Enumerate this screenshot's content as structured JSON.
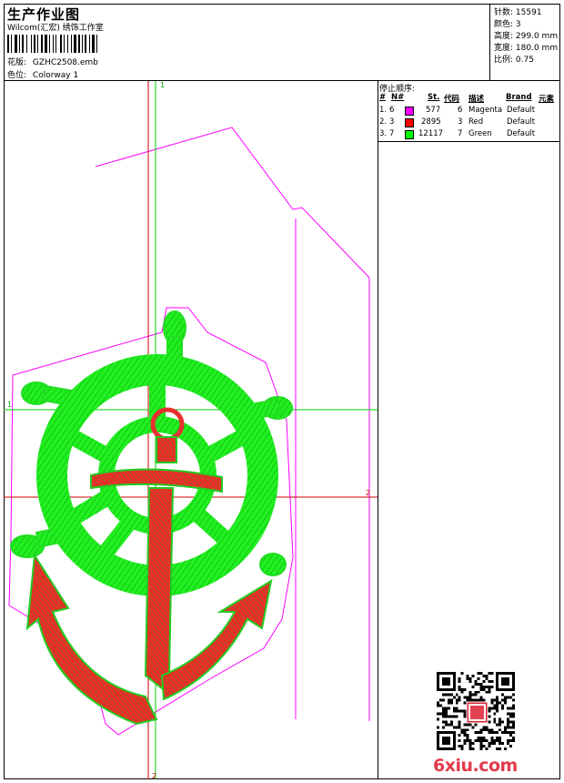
{
  "header": {
    "title": "生产作业图",
    "subtitle": "Wilcom(汇宏) 绣饰工作室",
    "design_label": "花版:",
    "design_value": "GZHC2508.emb",
    "colorway_label": "色位:",
    "colorway_value": "Colorway 1"
  },
  "stats": [
    {
      "label": "针数:",
      "value": "15591"
    },
    {
      "label": "颜色:",
      "value": "3"
    },
    {
      "label": "高度:",
      "value": "299.0 mm"
    },
    {
      "label": "宽度:",
      "value": "180.0 mm"
    },
    {
      "label": "比例:",
      "value": "0.75"
    }
  ],
  "stop_sequence": {
    "title": "停止顺序:",
    "headers": {
      "num": "#",
      "needle": "N#",
      "stitches": "St.",
      "code": "代码",
      "desc": "描述",
      "brand": "Brand",
      "element": "元素"
    },
    "rows": [
      {
        "num": "1.",
        "needle": "6",
        "color": "#ff00ff",
        "stitches": "577",
        "code": "6",
        "desc": "Magenta",
        "brand": "Default"
      },
      {
        "num": "2.",
        "needle": "3",
        "color": "#ff0000",
        "stitches": "2895",
        "code": "3",
        "desc": "Red",
        "brand": "Default"
      },
      {
        "num": "3.",
        "needle": "7",
        "color": "#00ff00",
        "stitches": "12117",
        "code": "7",
        "desc": "Green",
        "brand": "Default"
      }
    ]
  },
  "guides": {
    "v1": "1",
    "h1": "1",
    "h2": "2",
    "v2": "2"
  },
  "watermark": "6xiu.com",
  "colors": {
    "magenta": "#ff00ff",
    "red": "#ff0000",
    "green": "#00ff00",
    "guide_green": "#00cc00",
    "guide_red": "#cc0000"
  }
}
